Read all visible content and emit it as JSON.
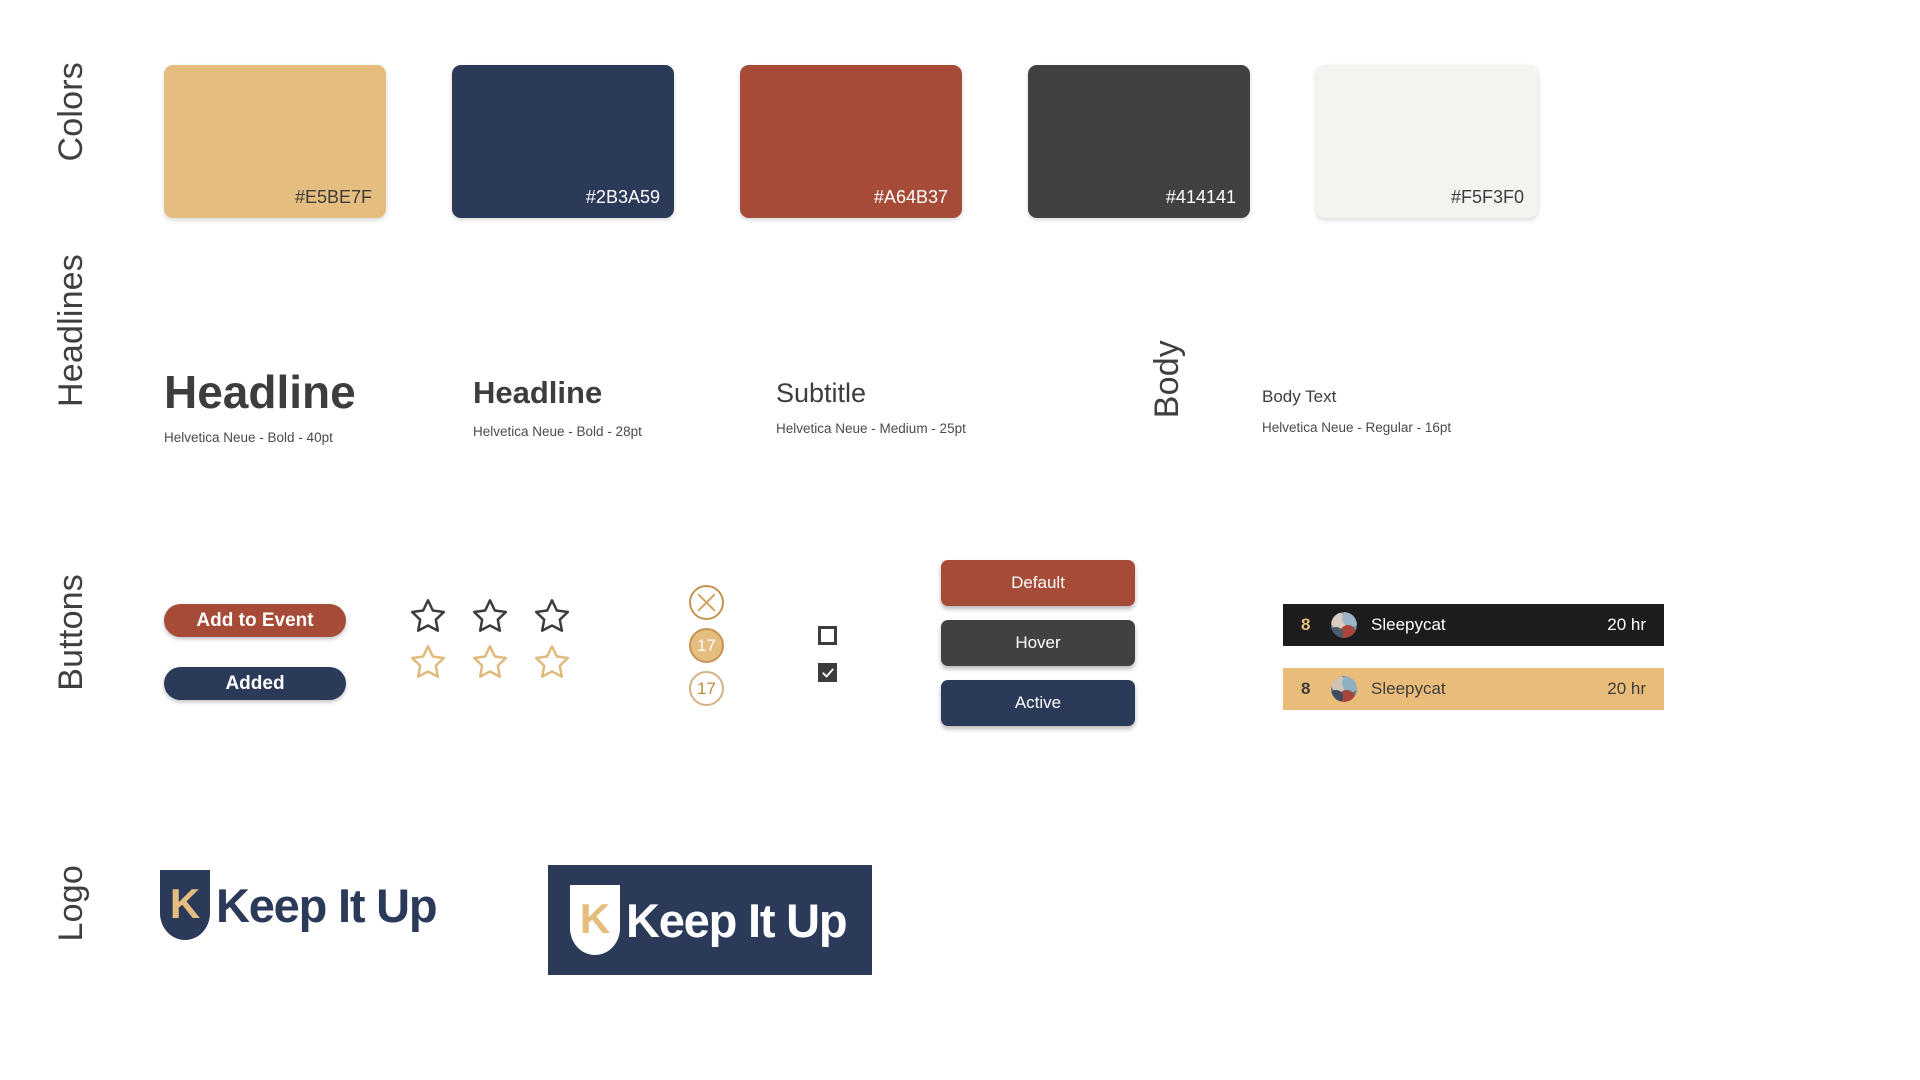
{
  "sections": {
    "colors": "Colors",
    "headlines": "Headlines",
    "body": "Body",
    "buttons": "Buttons",
    "logo": "Logo"
  },
  "palette": {
    "sand": "#E5BE7F",
    "navy": "#2B3A59",
    "rust": "#A64B37",
    "charcoal": "#414141",
    "offwhite": "#F5F3F0"
  },
  "swatches": [
    {
      "name": "sand",
      "hex": "#E5BE7F",
      "label_color": "#3d3d3d"
    },
    {
      "name": "navy",
      "hex": "#2B3A59",
      "label_color": "#ffffff"
    },
    {
      "name": "rust",
      "hex": "#A64B37",
      "label_color": "#ffffff"
    },
    {
      "name": "charcoal",
      "hex": "#414141",
      "label_color": "#ffffff"
    },
    {
      "name": "offwhite",
      "hex": "#F5F3F0",
      "label_color": "#3d3d3d"
    }
  ],
  "typography": [
    {
      "sample": "Headline",
      "spec": "Helvetica Neue - Bold - 40pt"
    },
    {
      "sample": "Headline",
      "spec": "Helvetica Neue - Bold - 28pt"
    },
    {
      "sample": "Subtitle",
      "spec": "Helvetica Neue - Medium - 25pt"
    },
    {
      "sample": "Body Text",
      "spec": "Helvetica Neue - Regular - 16pt"
    }
  ],
  "pills": [
    {
      "label": "Add to Event",
      "bg": "#A64B37"
    },
    {
      "label": "Added",
      "bg": "#2B3A59"
    }
  ],
  "ratings": {
    "empty_star_color": "#3c3c3c",
    "gold_star_color": "#e0ba7c",
    "star_count": 3
  },
  "counters": [
    {
      "state": "close",
      "value": ""
    },
    {
      "state": "filled",
      "value": "17"
    },
    {
      "state": "outline",
      "value": "17"
    }
  ],
  "checkboxes": [
    {
      "state": "unchecked"
    },
    {
      "state": "checked"
    }
  ],
  "state_buttons": [
    {
      "label": "Default",
      "bg": "#A64B37"
    },
    {
      "label": "Hover",
      "bg": "#414141"
    },
    {
      "label": "Active",
      "bg": "#2B3A59"
    }
  ],
  "leaderboard": [
    {
      "variant": "dark",
      "rank": "8",
      "name": "Sleepycat",
      "time": "20 hr",
      "bg": "#1c1c1c",
      "rank_color": "#e5be7f",
      "text_color": "#ffffff"
    },
    {
      "variant": "gold",
      "rank": "8",
      "name": "Sleepycat",
      "time": "20 hr",
      "bg": "#e9bd79",
      "rank_color": "#3d3d3d",
      "text_color": "#3d3d3d"
    }
  ],
  "logo": {
    "wordmark": "Keep It Up",
    "monogram": "K",
    "primary": {
      "shield_fill": "#2B3A59",
      "monogram_color": "#E5BE7F",
      "word_color": "#2B3A59"
    },
    "inverse": {
      "panel_bg": "#2B3A59",
      "shield_fill": "#FFFFFF",
      "monogram_color": "#E5BE7F",
      "word_color": "#FFFFFF"
    }
  }
}
